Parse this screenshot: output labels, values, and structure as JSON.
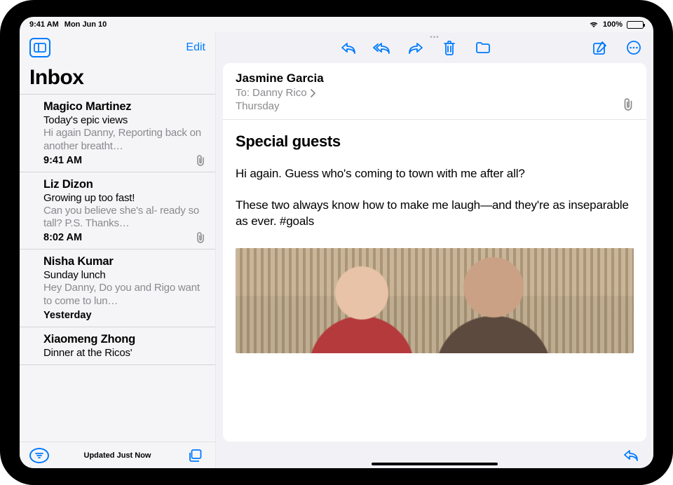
{
  "status": {
    "time": "9:41 AM",
    "date": "Mon Jun 10",
    "battery_pct": "100%"
  },
  "sidebar": {
    "edit_label": "Edit",
    "title": "Inbox",
    "footer_status": "Updated Just Now"
  },
  "messages": [
    {
      "sender": "Magico Martinez",
      "subject": "Today's epic views",
      "preview": "Hi again Danny, Reporting back on another breatht…",
      "time": "9:41 AM",
      "has_attachment": true
    },
    {
      "sender": "Liz Dizon",
      "subject": "Growing up too fast!",
      "preview": "Can you believe she's al- ready so tall? P.S. Thanks…",
      "time": "8:02 AM",
      "has_attachment": true
    },
    {
      "sender": "Nisha Kumar",
      "subject": "Sunday lunch",
      "preview": "Hey Danny, Do you and Rigo want to come to lun…",
      "time": "Yesterday",
      "has_attachment": false
    },
    {
      "sender": "Xiaomeng Zhong",
      "subject": "Dinner at the Ricos'",
      "preview": "",
      "time": "",
      "has_attachment": false
    }
  ],
  "mail": {
    "from": "Jasmine Garcia",
    "to_label": "To:",
    "to_name": "Danny Rico",
    "date": "Thursday",
    "subject": "Special guests",
    "body_p1": "Hi again. Guess who's coming to town with me after all?",
    "body_p2": "These two always know how to make me laugh—and they're as inseparable as ever. #goals"
  }
}
